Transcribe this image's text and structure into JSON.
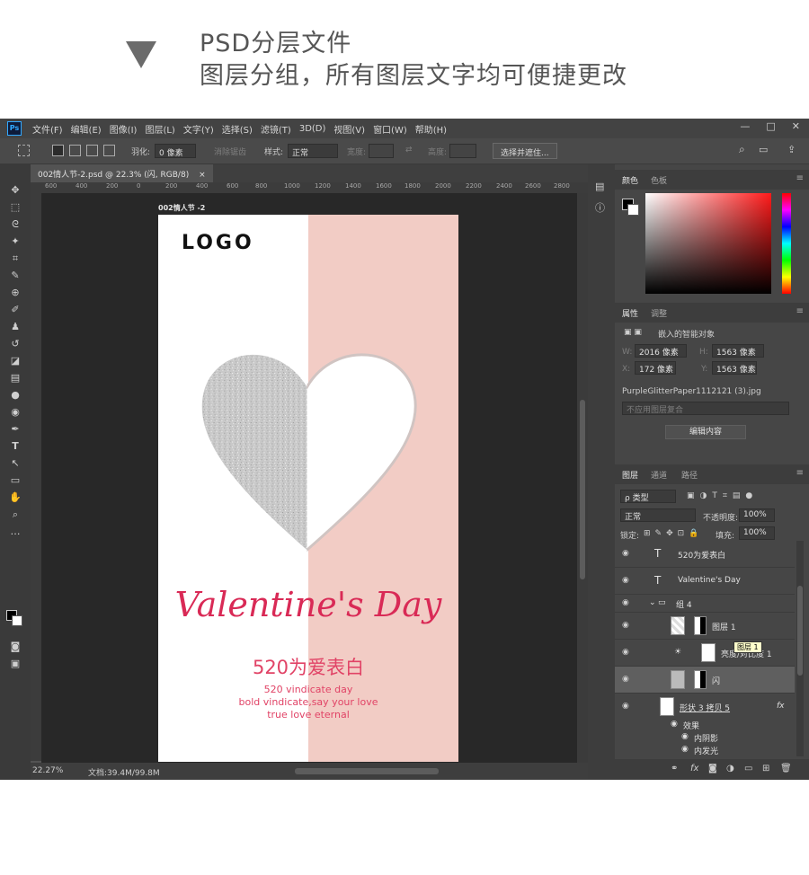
{
  "caption": {
    "line1": "PSD分层文件",
    "line2": "图层分组，所有图层文字均可便捷更改"
  },
  "menu": [
    "文件(F)",
    "编辑(E)",
    "图像(I)",
    "图层(L)",
    "文字(Y)",
    "选择(S)",
    "滤镜(T)",
    "3D(D)",
    "视图(V)",
    "窗口(W)",
    "帮助(H)"
  ],
  "window_controls": [
    "—",
    "□",
    "✕"
  ],
  "options_bar": {
    "feather_label": "羽化:",
    "feather_value": "0 像素",
    "antialias_label": "消除锯齿",
    "style_label": "样式:",
    "style_value": "正常",
    "width_label": "宽度:",
    "height_label": "高度:",
    "select_mask_button": "选择并遮住..."
  },
  "document": {
    "tab_title": "002情人节-2.psd @ 22.3% (闪, RGB/8)",
    "tab_close": "×",
    "canvas_label": "002情人节 -2",
    "ruler_ticks": [
      "600",
      "400",
      "200",
      "0",
      "200",
      "400",
      "600",
      "800",
      "1000",
      "1200",
      "1400",
      "1600",
      "1800",
      "2000",
      "2200",
      "2400",
      "2600",
      "2800"
    ]
  },
  "poster": {
    "logo": "LOGO",
    "script_title": "Valentine's Day",
    "cn_title": "520为爱表白",
    "en_lines": [
      "520 vindicate day",
      "bold vindicate,say your love",
      "true love eternal"
    ]
  },
  "status": {
    "zoom": "22.27%",
    "doc_size": "文档:39.4M/99.8M"
  },
  "color_panel": {
    "tabs": [
      "颜色",
      "色板"
    ]
  },
  "properties_panel": {
    "tabs": [
      "属性",
      "调整"
    ],
    "type_label": "嵌入的智能对象",
    "w_label": "W:",
    "w_value": "2016 像素",
    "h_label": "H:",
    "h_value": "1563 像素",
    "x_label": "X:",
    "x_value": "172 像素",
    "y_label": "Y:",
    "y_value": "1563 像素",
    "filename": "PurpleGlitterPaper1112121 (3).jpg",
    "comp_placeholder": "不应用图层复合",
    "edit_button": "编辑内容"
  },
  "layers_panel": {
    "tabs": [
      "图层",
      "通道",
      "路径"
    ],
    "filter_kind": "ρ 类型",
    "blend_mode": "正常",
    "opacity_label": "不透明度:",
    "opacity_value": "100%",
    "lock_label": "锁定:",
    "fill_label": "填充:",
    "fill_value": "100%",
    "layers": [
      {
        "name": "520为爱表白",
        "kind": "text"
      },
      {
        "name": "Valentine's Day",
        "kind": "text"
      },
      {
        "name": "组 4",
        "kind": "group"
      },
      {
        "name": "图层 1",
        "kind": "pixel"
      },
      {
        "name": "亮度/对比度 1",
        "kind": "adjustment"
      },
      {
        "name": "闪",
        "kind": "smart",
        "selected": true
      },
      {
        "name": "形状 3 拷贝 5",
        "kind": "shape",
        "fx": "fx"
      }
    ],
    "effects_label": "效果",
    "effects": [
      "内阴影",
      "内发光"
    ],
    "tooltip": "图层 1"
  }
}
